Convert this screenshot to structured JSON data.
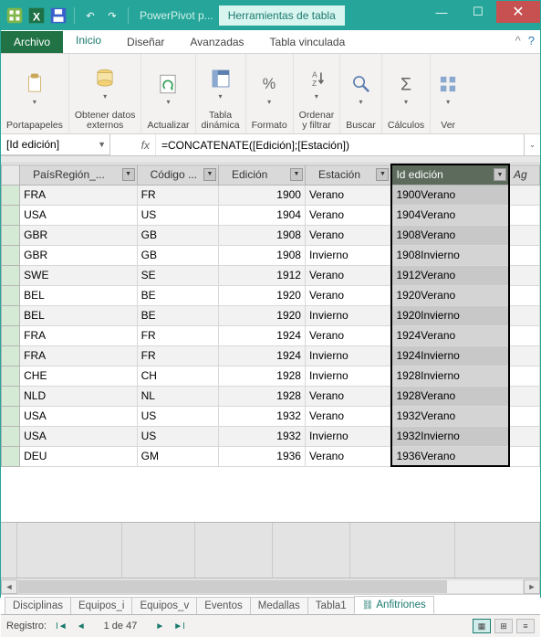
{
  "window": {
    "title": "PowerPivot p...",
    "context_tab": "Herramientas de tabla"
  },
  "ribbon_tabs": {
    "file": "Archivo",
    "inicio": "Inicio",
    "disenar": "Diseñar",
    "avanzadas": "Avanzadas",
    "vinculada": "Tabla vinculada"
  },
  "ribbon_groups": {
    "portapapeles": "Portapapeles",
    "obtener_datos": "Obtener datos\nexternos",
    "actualizar": "Actualizar",
    "tabla_dinamica": "Tabla\ndinámica",
    "formato": "Formato",
    "ordenar": "Ordenar\ny filtrar",
    "buscar": "Buscar",
    "calculos": "Cálculos",
    "ver": "Ver"
  },
  "formula_bar": {
    "name": "[Id edición]",
    "fx": "fx",
    "formula": "=CONCATENATE([Edición];[Estación])"
  },
  "columns": {
    "pais": "PaísRegión_...",
    "codigo": "Código ...",
    "edicion": "Edición",
    "estacion": "Estación",
    "id_edicion": "Id edición",
    "add": "Ag"
  },
  "rows": [
    {
      "pais": "FRA",
      "codigo": "FR",
      "edicion": "1900",
      "estacion": "Verano",
      "id": "1900Verano"
    },
    {
      "pais": "USA",
      "codigo": "US",
      "edicion": "1904",
      "estacion": "Verano",
      "id": "1904Verano"
    },
    {
      "pais": "GBR",
      "codigo": "GB",
      "edicion": "1908",
      "estacion": "Verano",
      "id": "1908Verano"
    },
    {
      "pais": "GBR",
      "codigo": "GB",
      "edicion": "1908",
      "estacion": "Invierno",
      "id": "1908Invierno"
    },
    {
      "pais": "SWE",
      "codigo": "SE",
      "edicion": "1912",
      "estacion": "Verano",
      "id": "1912Verano"
    },
    {
      "pais": "BEL",
      "codigo": "BE",
      "edicion": "1920",
      "estacion": "Verano",
      "id": "1920Verano"
    },
    {
      "pais": "BEL",
      "codigo": "BE",
      "edicion": "1920",
      "estacion": "Invierno",
      "id": "1920Invierno"
    },
    {
      "pais": "FRA",
      "codigo": "FR",
      "edicion": "1924",
      "estacion": "Verano",
      "id": "1924Verano"
    },
    {
      "pais": "FRA",
      "codigo": "FR",
      "edicion": "1924",
      "estacion": "Invierno",
      "id": "1924Invierno"
    },
    {
      "pais": "CHE",
      "codigo": "CH",
      "edicion": "1928",
      "estacion": "Invierno",
      "id": "1928Invierno"
    },
    {
      "pais": "NLD",
      "codigo": "NL",
      "edicion": "1928",
      "estacion": "Verano",
      "id": "1928Verano"
    },
    {
      "pais": "USA",
      "codigo": "US",
      "edicion": "1932",
      "estacion": "Verano",
      "id": "1932Verano"
    },
    {
      "pais": "USA",
      "codigo": "US",
      "edicion": "1932",
      "estacion": "Invierno",
      "id": "1932Invierno"
    },
    {
      "pais": "DEU",
      "codigo": "GM",
      "edicion": "1936",
      "estacion": "Verano",
      "id": "1936Verano"
    }
  ],
  "sheets": {
    "disciplinas": "Disciplinas",
    "equipos_i": "Equipos_i",
    "equipos_v": "Equipos_v",
    "eventos": "Eventos",
    "medallas": "Medallas",
    "tabla1": "Tabla1",
    "anfitriones": "Anfitriones"
  },
  "status": {
    "record_label": "Registro:",
    "position": "1 de 47"
  }
}
